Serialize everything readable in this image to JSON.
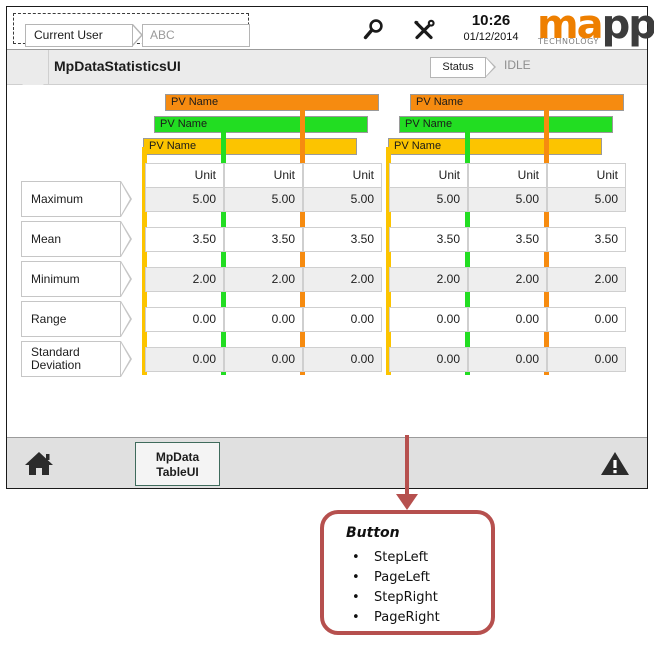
{
  "header": {
    "user_label": "Current User",
    "user_value": "ABC",
    "search_icon": "search-icon",
    "tools_icon": "tools-icon",
    "time": "10:26",
    "date": "01/12/2014",
    "logo_ma": "ma",
    "logo_pp": "pp",
    "logo_tech": "TECHNOLOGY"
  },
  "titlebar": {
    "page_title": "MpDataStatisticsUI",
    "status_label": "Status",
    "status_value": "IDLE"
  },
  "table": {
    "group_bars": [
      {
        "label": "PV Name",
        "color": "orange"
      },
      {
        "label": "PV Name",
        "color": "green"
      },
      {
        "label": "PV Name",
        "color": "yellow"
      },
      {
        "label": "PV Name",
        "color": "orange"
      },
      {
        "label": "PV Name",
        "color": "green"
      },
      {
        "label": "PV Name",
        "color": "yellow"
      }
    ],
    "unit_header": [
      "Unit",
      "Unit",
      "Unit",
      "Unit",
      "Unit",
      "Unit"
    ],
    "rows": [
      {
        "label": "Maximum",
        "values": [
          "5.00",
          "5.00",
          "5.00",
          "5.00",
          "5.00",
          "5.00"
        ]
      },
      {
        "label": "Mean",
        "values": [
          "3.50",
          "3.50",
          "3.50",
          "3.50",
          "3.50",
          "3.50"
        ]
      },
      {
        "label": "Minimum",
        "values": [
          "2.00",
          "2.00",
          "2.00",
          "2.00",
          "2.00",
          "2.00"
        ]
      },
      {
        "label": "Range",
        "values": [
          "0.00",
          "0.00",
          "0.00",
          "0.00",
          "0.00",
          "0.00"
        ]
      },
      {
        "label": "Standard\nDeviation",
        "label_line1": "Standard",
        "label_line2": "Deviation",
        "values": [
          "0.00",
          "0.00",
          "0.00",
          "0.00",
          "0.00",
          "0.00"
        ]
      }
    ]
  },
  "scrollbar": {
    "name": "horizontal-scrollbar",
    "thumb_color": "#f68b10"
  },
  "nav_buttons": [
    {
      "name": "page-left-button",
      "glyph": "double-left-arrow-icon"
    },
    {
      "name": "step-left-button",
      "glyph": "left-arrow-icon"
    },
    {
      "name": "step-right-button",
      "glyph": "right-arrow-icon"
    },
    {
      "name": "page-right-button",
      "glyph": "double-right-arrow-icon"
    }
  ],
  "bottombar": {
    "home_icon": "home-icon",
    "alarm_icon": "warning-triangle-icon",
    "tab_line1": "MpData",
    "tab_line2": "TableUI"
  },
  "callout": {
    "title": "Button",
    "items": [
      "StepLeft",
      "PageLeft",
      "StepRight",
      "PageRight"
    ],
    "accent_color": "#b6504e"
  },
  "colors": {
    "orange": "#f68b10",
    "green": "#22dd22",
    "yellow": "#fcc400",
    "accent": "#b6504e"
  }
}
